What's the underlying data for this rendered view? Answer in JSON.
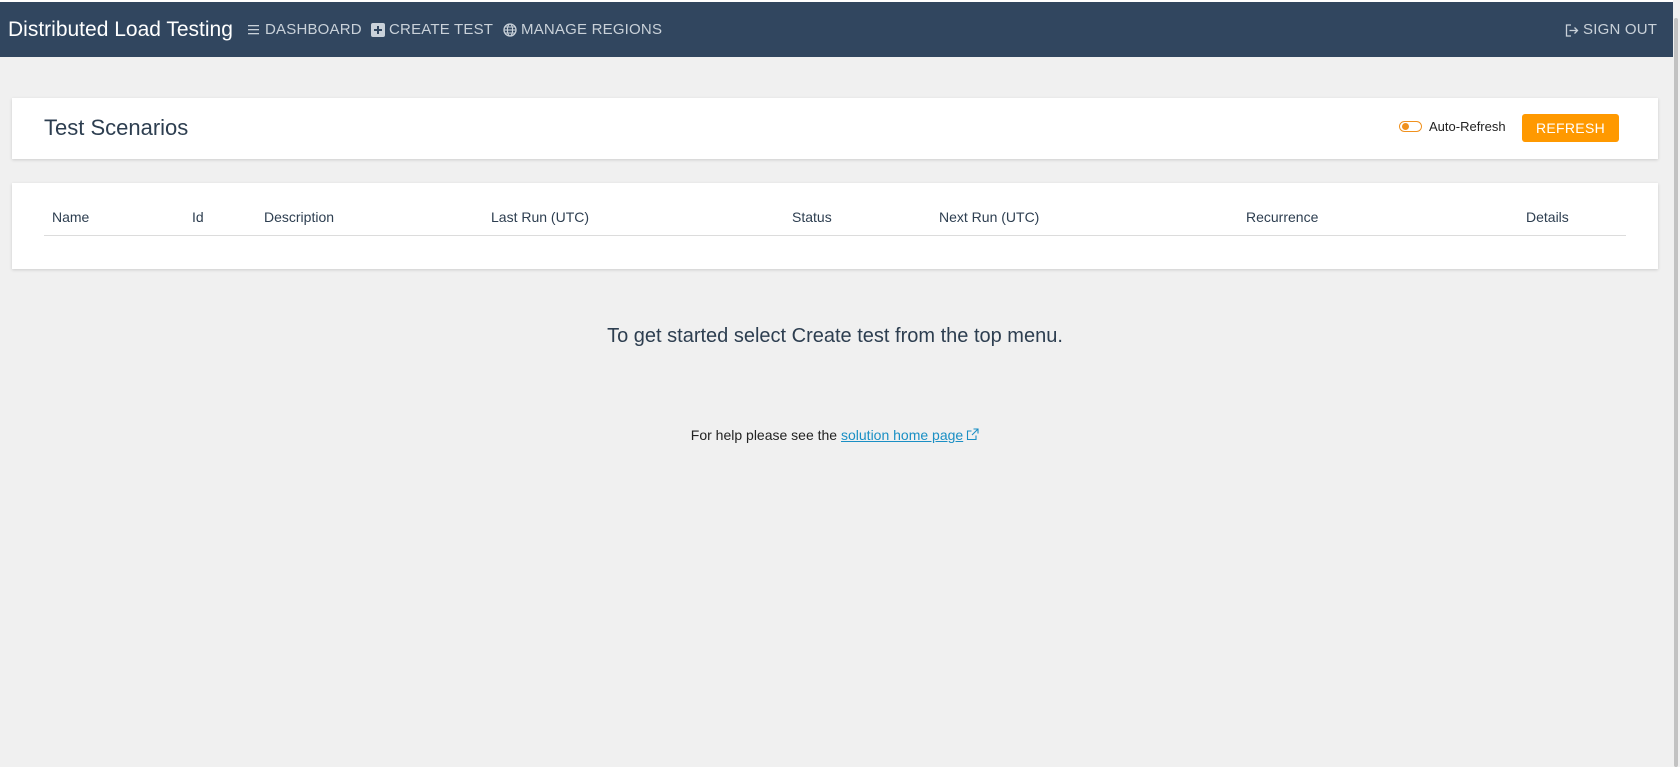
{
  "navbar": {
    "brand": "Distributed Load Testing",
    "items": [
      {
        "label": "DASHBOARD",
        "icon": "list-icon"
      },
      {
        "label": "CREATE TEST",
        "icon": "plus-square-icon"
      },
      {
        "label": "MANAGE REGIONS",
        "icon": "globe-icon"
      }
    ],
    "sign_out": {
      "label": "SIGN OUT",
      "icon": "sign-out-icon"
    }
  },
  "header": {
    "title": "Test Scenarios",
    "auto_refresh_label": "Auto-Refresh",
    "auto_refresh_on": false,
    "refresh_label": "REFRESH"
  },
  "table": {
    "columns": [
      "Name",
      "Id",
      "Description",
      "Last Run (UTC)",
      "Status",
      "Next Run (UTC)",
      "Recurrence",
      "Details"
    ],
    "rows": []
  },
  "empty_message": "To get started select Create test from the top menu.",
  "help": {
    "prefix": "For help please see the ",
    "link_text": "solution home page"
  },
  "colors": {
    "navbar_bg": "#31465f",
    "accent": "#ff9900",
    "link": "#1a8fc4",
    "page_bg": "#f0f0f0"
  }
}
